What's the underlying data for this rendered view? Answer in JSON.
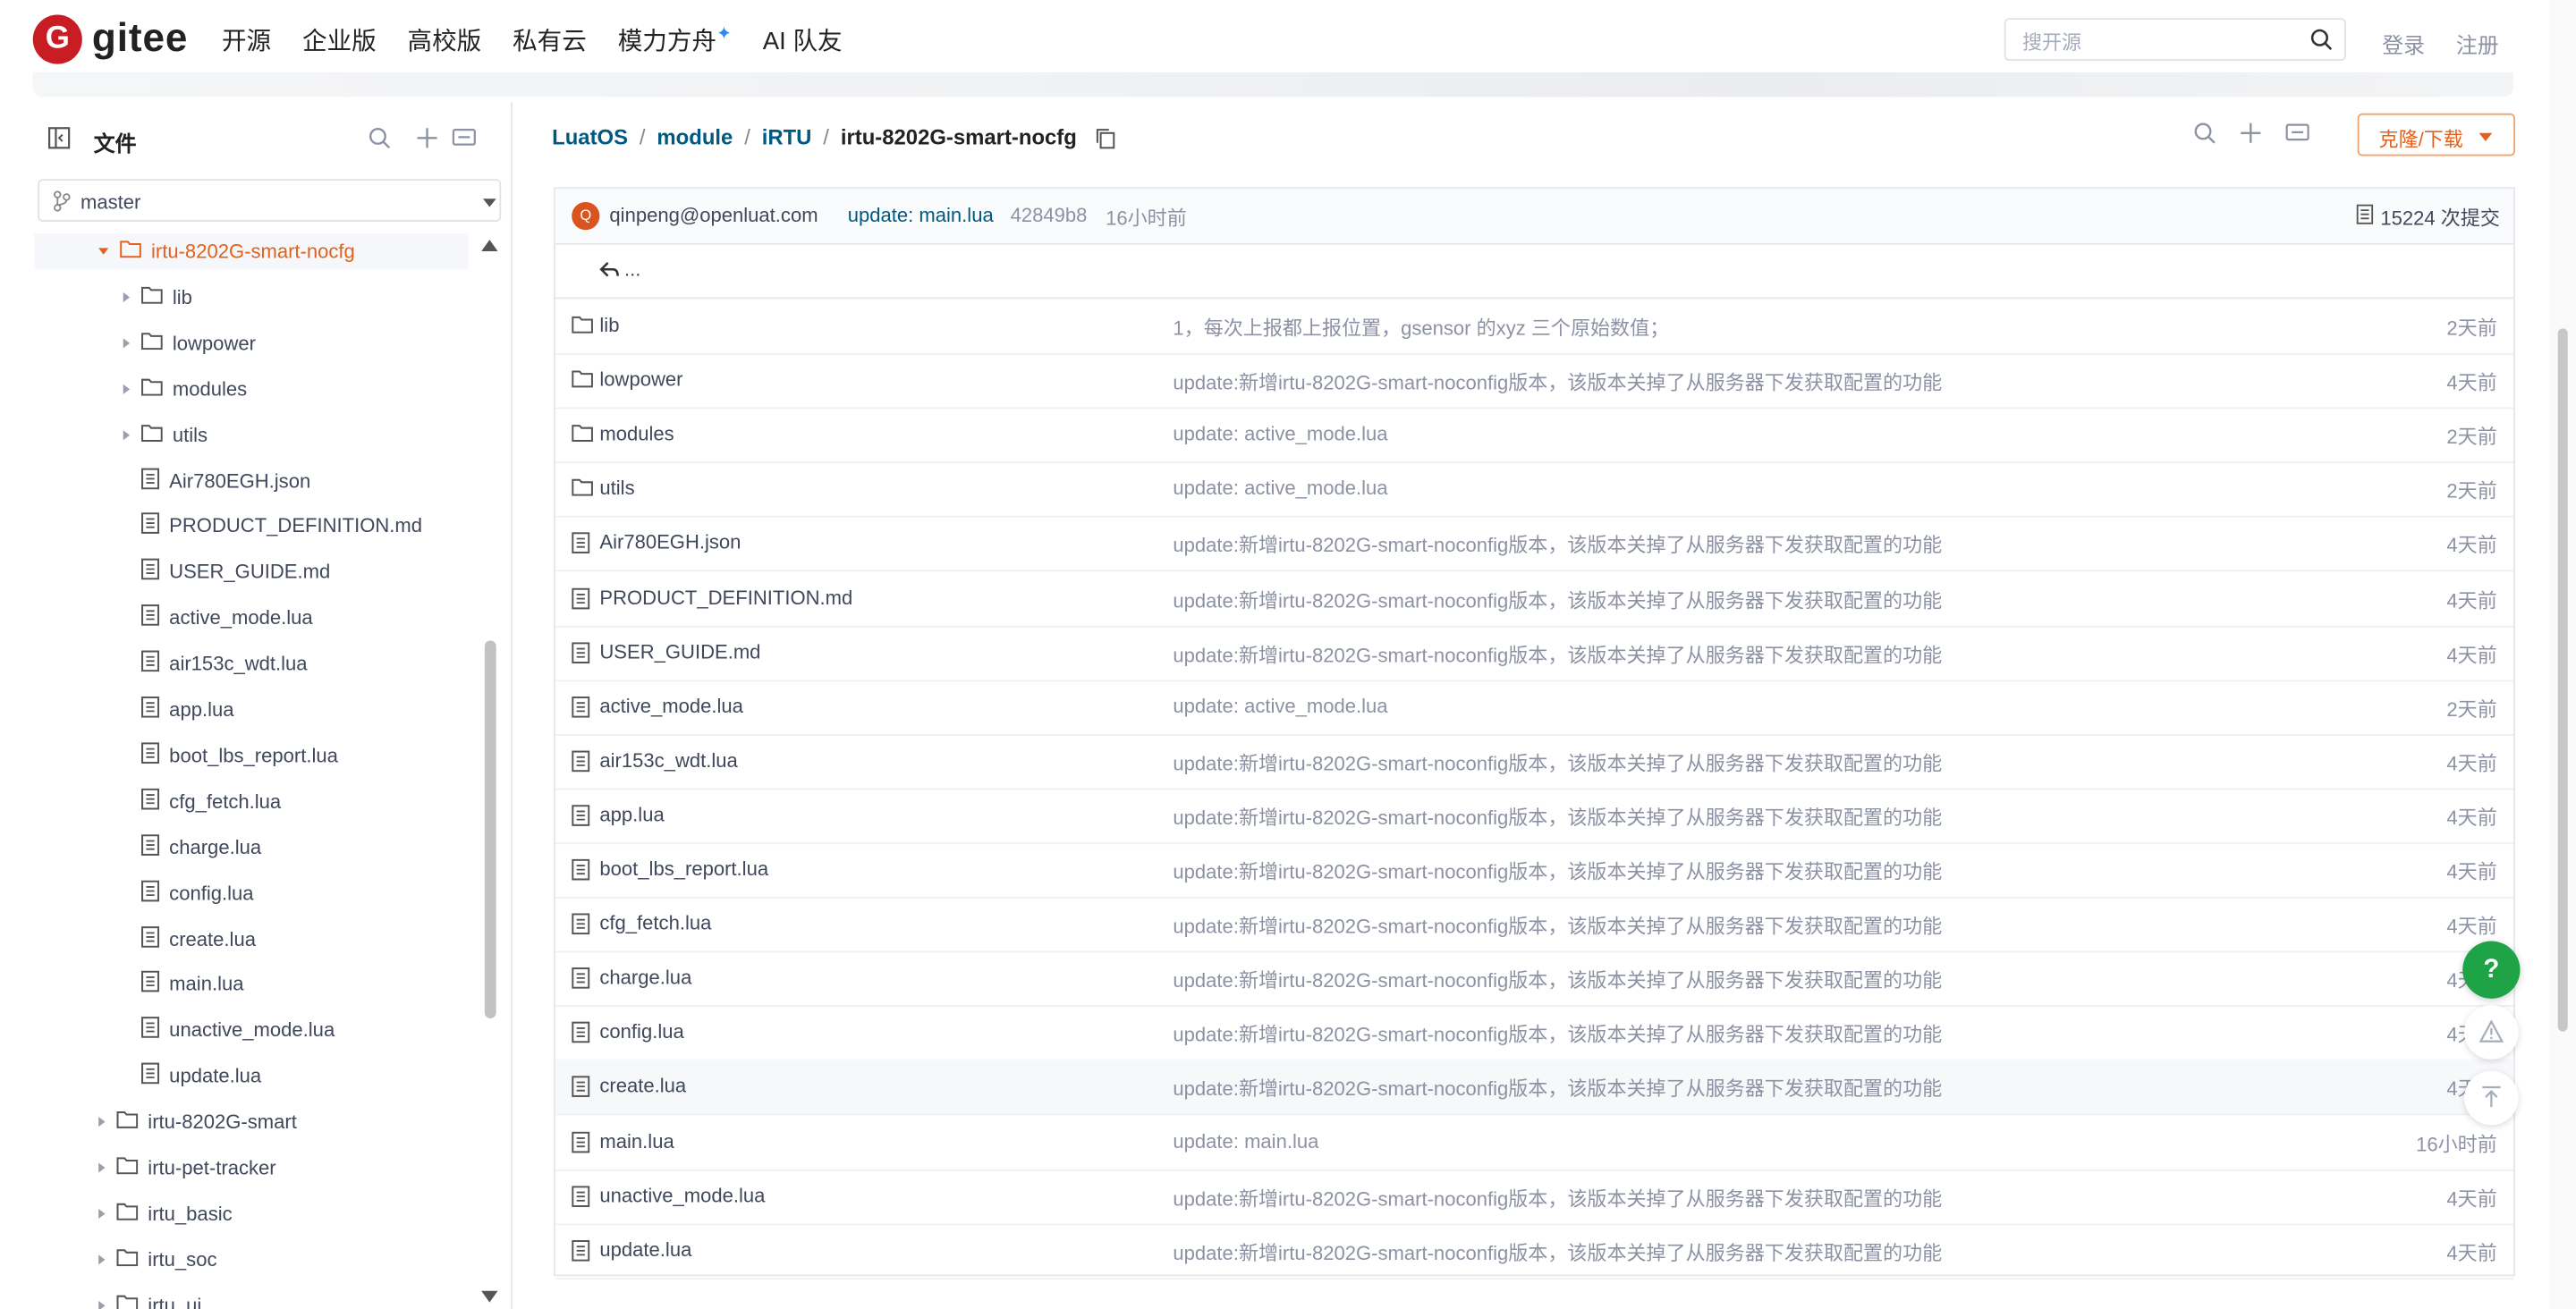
{
  "header": {
    "logo_text": "gitee",
    "nav": [
      "开源",
      "企业版",
      "高校版",
      "私有云",
      "模力方舟",
      "AI 队友"
    ],
    "search_placeholder": "搜开源",
    "login": "登录",
    "register": "注册"
  },
  "sidebar": {
    "title": "文件",
    "branch": "master",
    "tree": [
      {
        "label": "irtu-8202G-smart-nocfg",
        "type": "folder",
        "level": 1,
        "expanded": true,
        "selected": true
      },
      {
        "label": "lib",
        "type": "folder",
        "level": 2
      },
      {
        "label": "lowpower",
        "type": "folder",
        "level": 2
      },
      {
        "label": "modules",
        "type": "folder",
        "level": 2
      },
      {
        "label": "utils",
        "type": "folder",
        "level": 2
      },
      {
        "label": "Air780EGH.json",
        "type": "file",
        "level": 2
      },
      {
        "label": "PRODUCT_DEFINITION.md",
        "type": "file",
        "level": 2
      },
      {
        "label": "USER_GUIDE.md",
        "type": "file",
        "level": 2
      },
      {
        "label": "active_mode.lua",
        "type": "file",
        "level": 2
      },
      {
        "label": "air153c_wdt.lua",
        "type": "file",
        "level": 2
      },
      {
        "label": "app.lua",
        "type": "file",
        "level": 2
      },
      {
        "label": "boot_lbs_report.lua",
        "type": "file",
        "level": 2
      },
      {
        "label": "cfg_fetch.lua",
        "type": "file",
        "level": 2
      },
      {
        "label": "charge.lua",
        "type": "file",
        "level": 2
      },
      {
        "label": "config.lua",
        "type": "file",
        "level": 2
      },
      {
        "label": "create.lua",
        "type": "file",
        "level": 2
      },
      {
        "label": "main.lua",
        "type": "file",
        "level": 2
      },
      {
        "label": "unactive_mode.lua",
        "type": "file",
        "level": 2
      },
      {
        "label": "update.lua",
        "type": "file",
        "level": 2
      },
      {
        "label": "irtu-8202G-smart",
        "type": "folder",
        "level": 1
      },
      {
        "label": "irtu-pet-tracker",
        "type": "folder",
        "level": 1
      },
      {
        "label": "irtu_basic",
        "type": "folder",
        "level": 1
      },
      {
        "label": "irtu_soc",
        "type": "folder",
        "level": 1
      },
      {
        "label": "irtu_ui",
        "type": "folder",
        "level": 1
      }
    ]
  },
  "breadcrumb": {
    "segments": [
      "LuatOS",
      "module",
      "iRTU"
    ],
    "current": "irtu-8202G-smart-nocfg"
  },
  "clone_button": "克隆/下载",
  "commit": {
    "avatar_letter": "Q",
    "author": "qinpeng@openluat.com",
    "message": "update: main.lua",
    "hash": "42849b8",
    "time": "16小时前",
    "count": "15224 次提交"
  },
  "back_label": "...",
  "files": [
    {
      "name": "lib",
      "type": "folder",
      "msg": "1，每次上报都上报位置，gsensor 的xyz 三个原始数值；",
      "time": "2天前"
    },
    {
      "name": "lowpower",
      "type": "folder",
      "msg": "update:新增irtu-8202G-smart-noconfig版本，该版本关掉了从服务器下发获取配置的功能",
      "time": "4天前"
    },
    {
      "name": "modules",
      "type": "folder",
      "msg": "update: active_mode.lua",
      "time": "2天前"
    },
    {
      "name": "utils",
      "type": "folder",
      "msg": "update: active_mode.lua",
      "time": "2天前"
    },
    {
      "name": "Air780EGH.json",
      "type": "file",
      "msg": "update:新增irtu-8202G-smart-noconfig版本，该版本关掉了从服务器下发获取配置的功能",
      "time": "4天前"
    },
    {
      "name": "PRODUCT_DEFINITION.md",
      "type": "file",
      "msg": "update:新增irtu-8202G-smart-noconfig版本，该版本关掉了从服务器下发获取配置的功能",
      "time": "4天前"
    },
    {
      "name": "USER_GUIDE.md",
      "type": "file",
      "msg": "update:新增irtu-8202G-smart-noconfig版本，该版本关掉了从服务器下发获取配置的功能",
      "time": "4天前"
    },
    {
      "name": "active_mode.lua",
      "type": "file",
      "msg": "update: active_mode.lua",
      "time": "2天前"
    },
    {
      "name": "air153c_wdt.lua",
      "type": "file",
      "msg": "update:新增irtu-8202G-smart-noconfig版本，该版本关掉了从服务器下发获取配置的功能",
      "time": "4天前"
    },
    {
      "name": "app.lua",
      "type": "file",
      "msg": "update:新增irtu-8202G-smart-noconfig版本，该版本关掉了从服务器下发获取配置的功能",
      "time": "4天前"
    },
    {
      "name": "boot_lbs_report.lua",
      "type": "file",
      "msg": "update:新增irtu-8202G-smart-noconfig版本，该版本关掉了从服务器下发获取配置的功能",
      "time": "4天前"
    },
    {
      "name": "cfg_fetch.lua",
      "type": "file",
      "msg": "update:新增irtu-8202G-smart-noconfig版本，该版本关掉了从服务器下发获取配置的功能",
      "time": "4天前"
    },
    {
      "name": "charge.lua",
      "type": "file",
      "msg": "update:新增irtu-8202G-smart-noconfig版本，该版本关掉了从服务器下发获取配置的功能",
      "time": "4天前"
    },
    {
      "name": "config.lua",
      "type": "file",
      "msg": "update:新增irtu-8202G-smart-noconfig版本，该版本关掉了从服务器下发获取配置的功能",
      "time": "4天前"
    },
    {
      "name": "create.lua",
      "type": "file",
      "msg": "update:新增irtu-8202G-smart-noconfig版本，该版本关掉了从服务器下发获取配置的功能",
      "time": "4天前",
      "highlight": true
    },
    {
      "name": "main.lua",
      "type": "file",
      "msg": "update: main.lua",
      "time": "16小时前"
    },
    {
      "name": "unactive_mode.lua",
      "type": "file",
      "msg": "update:新增irtu-8202G-smart-noconfig版本，该版本关掉了从服务器下发获取配置的功能",
      "time": "4天前"
    },
    {
      "name": "update.lua",
      "type": "file",
      "msg": "update:新增irtu-8202G-smart-noconfig版本，该版本关掉了从服务器下发获取配置的功能",
      "time": "4天前"
    }
  ],
  "help_label": "?",
  "colors": {
    "brand": "#c71d23",
    "accent": "#e4601b",
    "link": "#005980",
    "help": "#1fa347"
  }
}
